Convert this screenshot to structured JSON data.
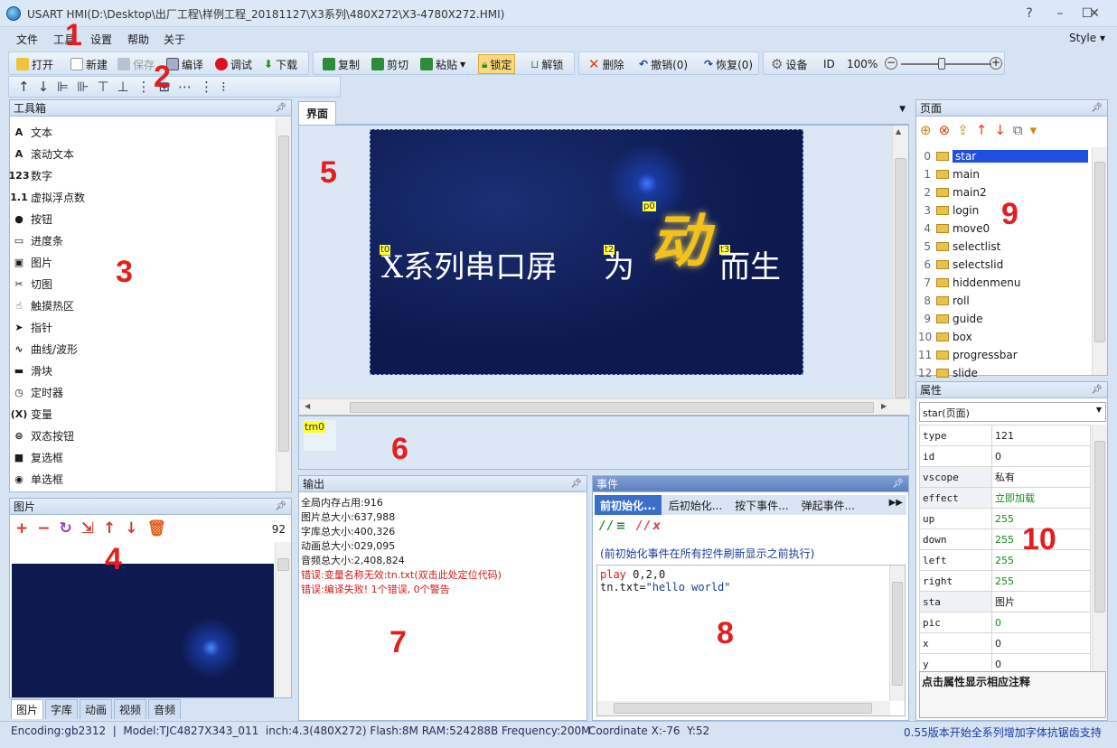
{
  "app": {
    "title": "USART HMI(D:\\Desktop\\出厂工程\\样例工程_20181127\\X3系列\\480X272\\X3-4780X272.HMI)",
    "window_controls": [
      "?",
      "–",
      "☐",
      "✕"
    ]
  },
  "menu": {
    "items": [
      "文件",
      "工具",
      "设置",
      "帮助",
      "关于"
    ],
    "style_label": "Style ▾"
  },
  "toolbar1": {
    "open": "打开",
    "new": "新建",
    "save": "保存",
    "compile": "编译",
    "debug": "调试",
    "download": "下载",
    "copy": "复制",
    "cut": "剪切",
    "paste": "粘贴",
    "lock": "锁定",
    "unlock": "解锁",
    "delete": "删除",
    "undo": "撤销(0)",
    "redo": "恢复(0)",
    "device": "设备",
    "id": "ID",
    "zoom": "100%",
    "zoom_level": 0.45
  },
  "annotations": [
    "1",
    "2",
    "3",
    "4",
    "5",
    "6",
    "7",
    "8",
    "9",
    "10"
  ],
  "toolbox": {
    "title": "工具箱",
    "items": [
      {
        "icon": "text-icon",
        "glyph": "A",
        "label": "文本"
      },
      {
        "icon": "scroll-text-icon",
        "glyph": "A",
        "label": "滚动文本"
      },
      {
        "icon": "number-icon",
        "glyph": "123",
        "label": "数字"
      },
      {
        "icon": "float-icon",
        "glyph": "1.1",
        "label": "虚拟浮点数"
      },
      {
        "icon": "button-icon",
        "glyph": "●",
        "label": "按钮"
      },
      {
        "icon": "progress-icon",
        "glyph": "▭",
        "label": "进度条"
      },
      {
        "icon": "picture-icon",
        "glyph": "▣",
        "label": "图片"
      },
      {
        "icon": "crop-icon",
        "glyph": "✂",
        "label": "切图"
      },
      {
        "icon": "hotspot-icon",
        "glyph": "☝",
        "label": "触摸热区"
      },
      {
        "icon": "pointer-icon",
        "glyph": "➤",
        "label": "指针"
      },
      {
        "icon": "curve-icon",
        "glyph": "∿",
        "label": "曲线/波形"
      },
      {
        "icon": "slider-icon",
        "glyph": "▬",
        "label": "滑块"
      },
      {
        "icon": "timer-icon",
        "glyph": "◷",
        "label": "定时器"
      },
      {
        "icon": "variable-icon",
        "glyph": "(X)",
        "label": "变量"
      },
      {
        "icon": "dual-button-icon",
        "glyph": "⊜",
        "label": "双态按钮"
      },
      {
        "icon": "checkbox-icon",
        "glyph": "■",
        "label": "复选框"
      },
      {
        "icon": "radio-icon",
        "glyph": "◉",
        "label": "单选框"
      }
    ]
  },
  "picture_panel": {
    "title": "图片",
    "count": "92",
    "tabs": [
      "图片",
      "字库",
      "动画",
      "视频",
      "音频"
    ]
  },
  "canvas": {
    "tab": "界面",
    "tags": {
      "t0": "t0",
      "t2": "t2",
      "t3": "t3",
      "p0": "p0"
    },
    "text_left": "X系列串口屏",
    "text_mid": "为",
    "text_dong": "动",
    "text_right": "而生"
  },
  "timer_area": {
    "tag": "tm0"
  },
  "output": {
    "title": "输出",
    "lines": [
      {
        "text": "全局内存占用:916",
        "error": false
      },
      {
        "text": "图片总大小:637,988",
        "error": false
      },
      {
        "text": "字库总大小:400,326",
        "error": false
      },
      {
        "text": "动画总大小:029,095",
        "error": false
      },
      {
        "text": "音频总大小:2,408,824",
        "error": false
      },
      {
        "text": "错误:变量名称无效:tn.txt(双击此处定位代码)",
        "error": true
      },
      {
        "text": "错误:编译失败! 1个错误, 0个警告",
        "error": true
      }
    ]
  },
  "events": {
    "title": "事件",
    "tabs": [
      "前初始化...",
      "后初始化...",
      "按下事件...",
      "弹起事件..."
    ],
    "hint": "(前初始化事件在所有控件刷新显示之前执行)",
    "code_line1_kw": "play",
    "code_line1_rest": " 0,2,0",
    "code_line2_var": "tn.txt=",
    "code_line2_str": "\"hello world\""
  },
  "pages": {
    "title": "页面",
    "items": [
      "star",
      "main",
      "main2",
      "login",
      "move0",
      "selectlist",
      "selectslid",
      "hiddenmenu",
      "roll",
      "guide",
      "box",
      "progressbar",
      "slide"
    ]
  },
  "properties": {
    "title": "属性",
    "selector": "star(页面)",
    "rows": [
      {
        "k": "type",
        "v": "121",
        "color": "#1a1a1a"
      },
      {
        "k": "id",
        "v": "0",
        "color": "#1a1a1a"
      },
      {
        "k": "vscope",
        "v": "私有",
        "color": "#1a1a1a"
      },
      {
        "k": "effect",
        "v": "立即加载",
        "color": "#138a13"
      },
      {
        "k": "up",
        "v": "255",
        "color": "#138a13"
      },
      {
        "k": "down",
        "v": "255",
        "color": "#138a13"
      },
      {
        "k": "left",
        "v": "255",
        "color": "#138a13"
      },
      {
        "k": "right",
        "v": "255",
        "color": "#138a13"
      },
      {
        "k": "sta",
        "v": "图片",
        "color": "#1a1a1a"
      },
      {
        "k": "pic",
        "v": "0",
        "color": "#138a13"
      },
      {
        "k": "x",
        "v": "0",
        "color": "#1a1a1a"
      },
      {
        "k": "y",
        "v": "0",
        "color": "#1a1a1a"
      }
    ],
    "hint": "点击属性显示相应注释"
  },
  "status": {
    "left": "Encoding:gb2312  |  Model:TJC4827X343_011  inch:4.3(480X272) Flash:8M RAM:524288B Frequency:200M",
    "coord": "Coordinate X:-76  Y:52",
    "right": "0.55版本开始全系列增加字体抗锯齿支持"
  },
  "colors": {
    "annotation": "#e41e1e",
    "canvas_bg": "#0d1a4f",
    "selection": "#1f4fe0"
  }
}
